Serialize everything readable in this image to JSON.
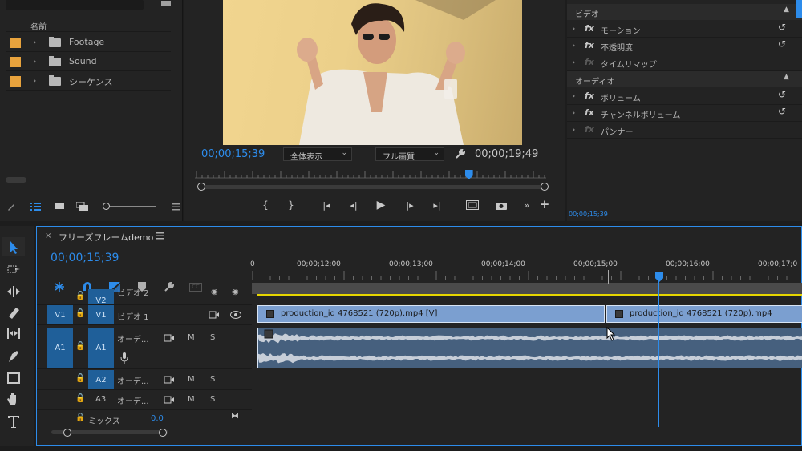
{
  "project_panel": {
    "column_name": "名前",
    "items": [
      {
        "label": "Footage"
      },
      {
        "label": "Sound"
      },
      {
        "label": "シーケンス"
      }
    ]
  },
  "program_monitor": {
    "current_time": "00;00;15;39",
    "fit_select": "全体表示",
    "quality_select": "フル画質",
    "duration": "00;00;19;49",
    "playhead_fraction": 0.78
  },
  "effect_controls": {
    "video_header": "ビデオ",
    "video_effects": [
      "モーション",
      "不透明度",
      "タイムリマップ"
    ],
    "audio_header": "オーディオ",
    "audio_effects": [
      "ボリューム",
      "チャンネルボリューム",
      "パンナー"
    ],
    "timecode": "00;00;15;39"
  },
  "timeline": {
    "sequence_name": "フリーズフレームdemo",
    "current_time": "00;00;15;39",
    "ruler": [
      "0",
      "00;00;12;00",
      "00;00;13;00",
      "00;00;14;00",
      "00;00;15;00",
      "00;00;16;00",
      "00;00;17;0"
    ],
    "tracks": {
      "v2": {
        "name": "ビデオ 2",
        "label": "V2"
      },
      "v1": {
        "name": "ビデオ 1",
        "label": "V1",
        "source": "V1"
      },
      "a1": {
        "name": "オーデ...",
        "label": "A1",
        "source": "A1"
      },
      "a2": {
        "name": "オーデ...",
        "label": "A2"
      },
      "a3": {
        "name": "オーデ...",
        "label": "A3"
      },
      "mix": {
        "name": "ミックス",
        "value": "0.0"
      }
    },
    "clips": [
      {
        "label": "production_id 4768521 (720p).mp4 [V]"
      },
      {
        "label": "production_id 4768521 (720p).mp4"
      }
    ],
    "track_buttons": {
      "mute": "M",
      "solo": "S"
    },
    "cc_label": "CC"
  },
  "colors": {
    "accent": "#2d8ceb",
    "label_orange": "#e8a33d",
    "clip_video": "#7b9fd0",
    "clip_audio": "#46607e"
  }
}
